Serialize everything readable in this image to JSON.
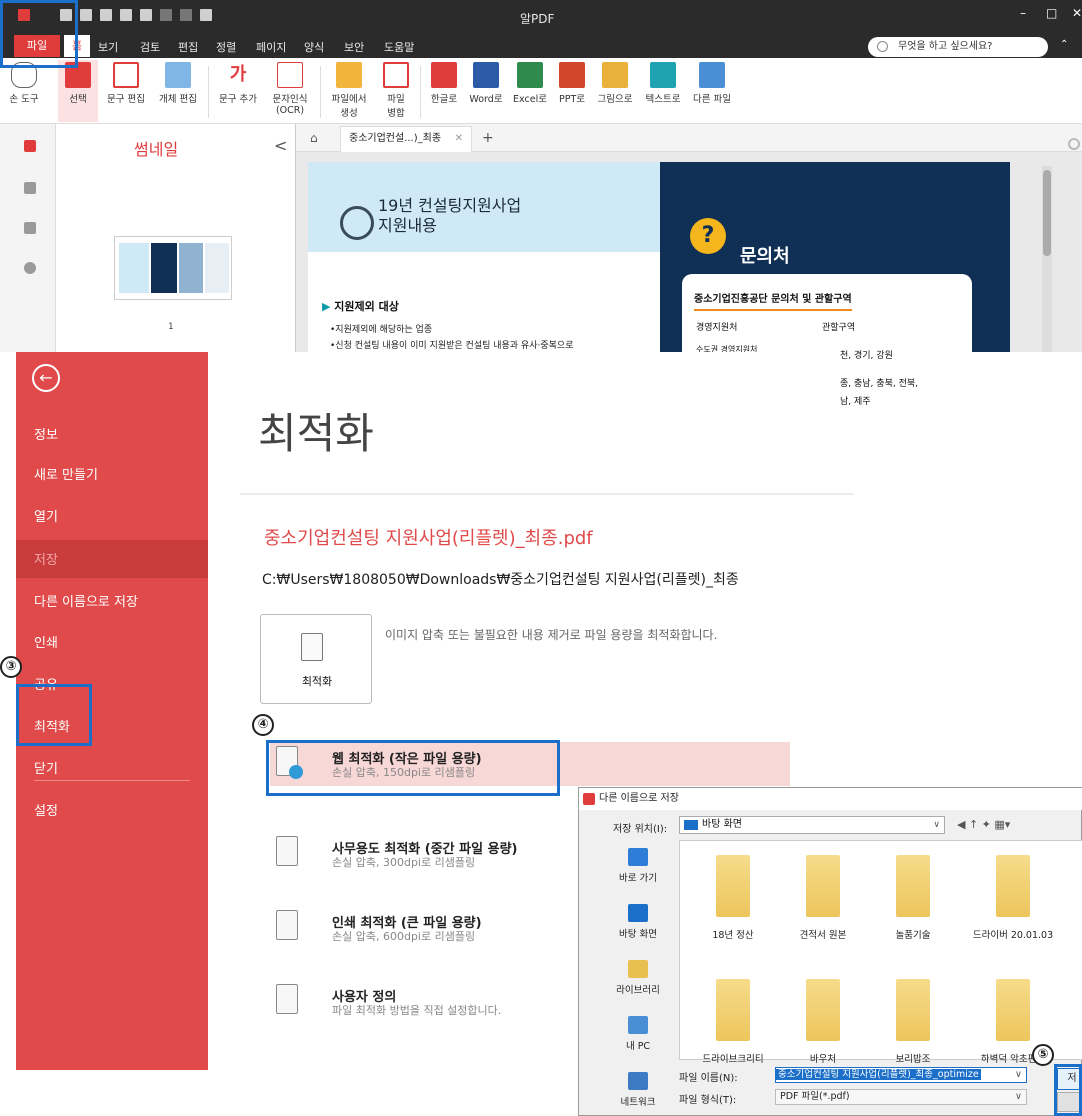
{
  "app": {
    "title": "알PDF",
    "menu": {
      "file": "파일",
      "home": "홈",
      "items": [
        "보기",
        "검토",
        "편집",
        "정렬",
        "페이지",
        "양식",
        "보안",
        "도움말"
      ]
    },
    "search_placeholder": "무엇을 하고 싶으세요?",
    "ribbon": [
      "손 도구",
      "선택",
      "문구 편집",
      "개체 편집",
      "문구 추가",
      "문자인식\n(OCR)",
      "파일에서\n생성",
      "파일\n병합",
      "한글로",
      "Word로",
      "Excel로",
      "PPT로",
      "그림으로",
      "텍스트로",
      "다른 파일"
    ],
    "thumbnail_title": "썸네일",
    "thumbnail_page": "1",
    "doc_tab": "중소기업컨설...)_최종",
    "doc": {
      "heading": "19년 컨설팅지원사업\n지원내용",
      "target_heading": "지원제외 대상",
      "bullets": [
        "•지원제외에 해당하는 업종",
        "•신청 컨설팅 내용이 이미 지원받은 컨설팅 내용과 유사·중복으로"
      ],
      "contact_title": "문의처",
      "card_title": "중소기업진흥공단 문의처 및 관할구역",
      "card_headers": [
        "경영지원처",
        "관할구역"
      ],
      "card_row": "수도권 경영지원처",
      "region_lines": [
        "천, 경기, 강원",
        "종, 충남, 충북, 전북,",
        "남, 제주"
      ]
    }
  },
  "backstage": {
    "items": [
      "정보",
      "새로 만들기",
      "열기",
      "저장",
      "다른 이름으로 저장",
      "인쇄",
      "공유",
      "최적화",
      "닫기",
      "설정"
    ],
    "title": "최적화",
    "file_name": "중소기업컨설팅 지원사업(리플렛)_최종.pdf",
    "file_path": "C:₩Users₩1808050₩Downloads₩중소기업컨설팅 지원사업(리플렛)_최종",
    "tile_label": "최적화",
    "tile_desc": "이미지 압축 또는 불필요한 내용 제거로 파일 용량을 최적화합니다.",
    "options": [
      {
        "title": "웹 최적화 (작은 파일 용량)",
        "sub": "손실 압축, 150dpi로 리샘플링"
      },
      {
        "title": "사무용도 최적화 (중간 파일 용량)",
        "sub": "손실 압축, 300dpi로 리샘플링"
      },
      {
        "title": "인쇄 최적화 (큰 파일 용량)",
        "sub": "손실 압축, 600dpi로 리샘플링"
      },
      {
        "title": "사용자 정의",
        "sub": "파일 최적화 방법을 직접 설정합니다."
      }
    ]
  },
  "dialog": {
    "title": "다른 이름으로 저장",
    "location_label": "저장 위치(I):",
    "location": "바탕 화면",
    "places": [
      "바로 가기",
      "바탕 화면",
      "라이브러리",
      "내 PC",
      "네트워크"
    ],
    "folders": [
      "18년 정산",
      "견적서 원본",
      "놀품기술",
      "드라이버 20.01.03",
      "드라이브크리티",
      "바우처",
      "보리밥조",
      "하벽덕 악초편사"
    ],
    "filename_label": "파일 이름(N):",
    "filename": "중소기업컨설팅 지원사업(리플렛)_최종_optimize",
    "filetype_label": "파일 형식(T):",
    "filetype": "PDF 파일(*.pdf)",
    "save_label": "저"
  },
  "badges": [
    "③",
    "④",
    "⑤"
  ],
  "colors": {
    "accent": "#e04a4a",
    "highlight": "#1b6fc8"
  }
}
